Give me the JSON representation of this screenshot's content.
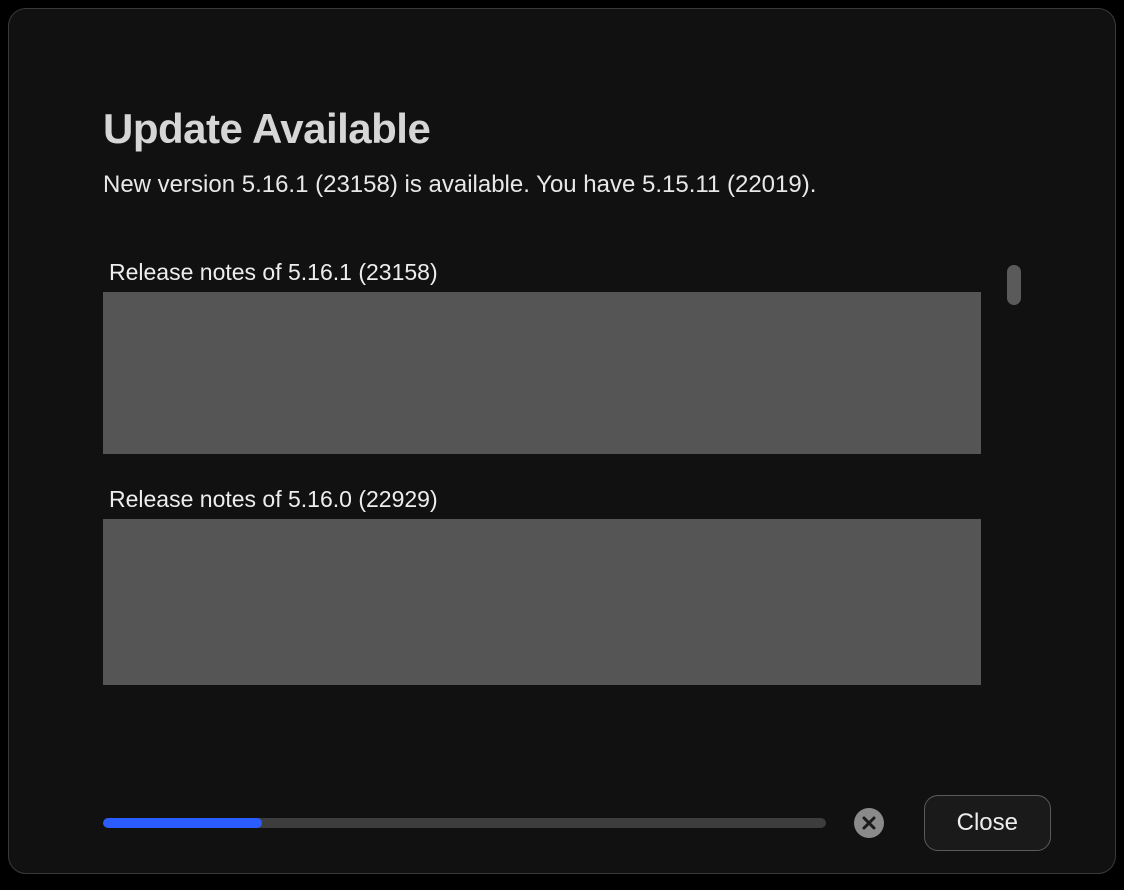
{
  "dialog": {
    "title": "Update Available",
    "subtitle": "New version 5.16.1 (23158) is available. You have 5.15.11 (22019).",
    "close_label": "Close"
  },
  "release_notes": [
    {
      "heading": "Release notes of 5.16.1 (23158)"
    },
    {
      "heading": "Release notes of 5.16.0 (22929)"
    }
  ],
  "progress": {
    "percent": 22
  },
  "icons": {
    "cancel": "close-circle-icon"
  }
}
